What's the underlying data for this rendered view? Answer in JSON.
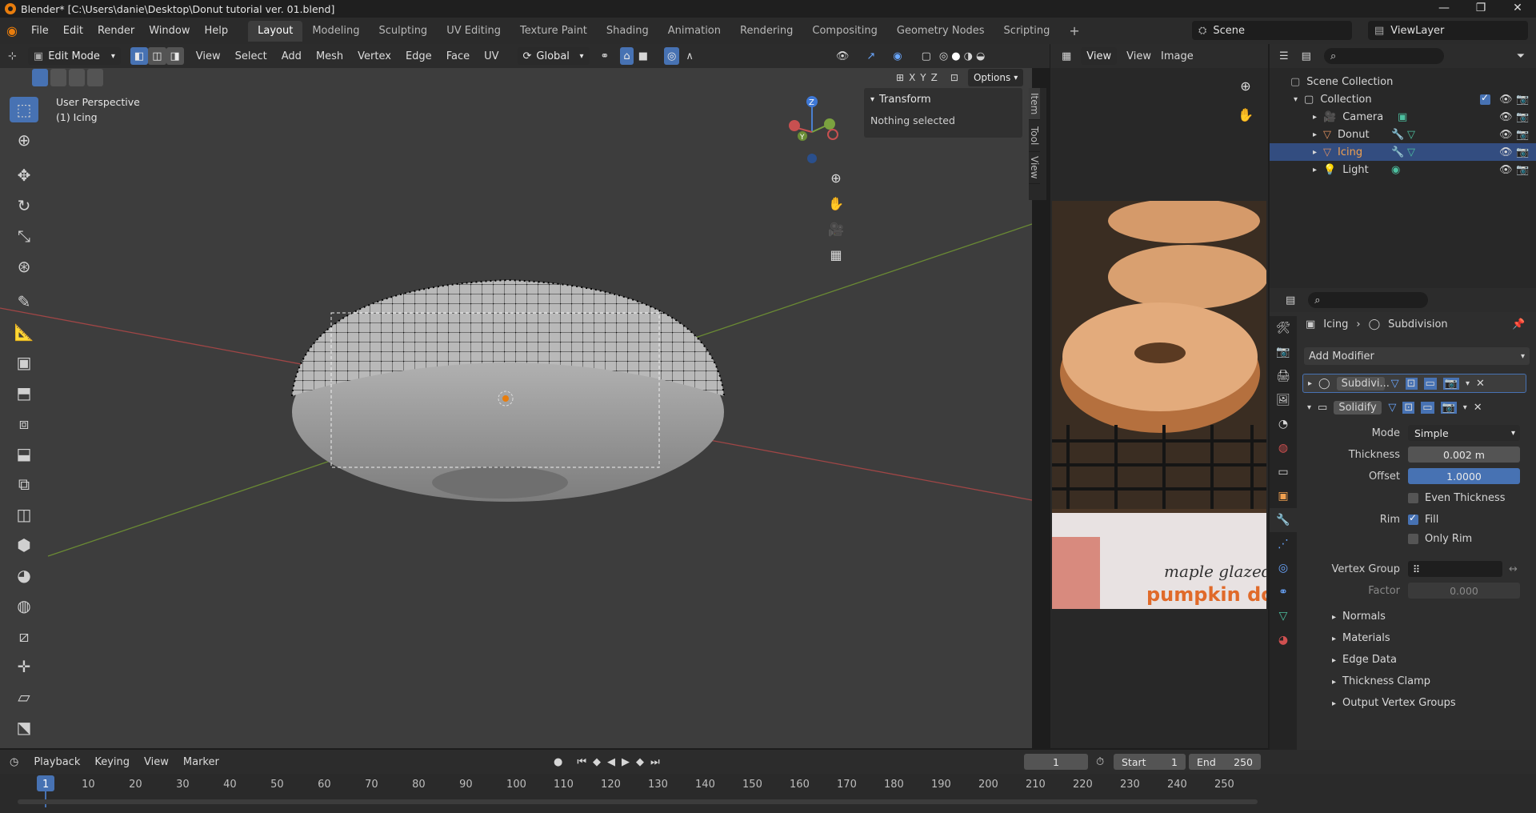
{
  "window": {
    "title": "Blender* [C:\\Users\\danie\\Desktop\\Donut tutorial ver. 01.blend]",
    "controls": [
      "—",
      "❐",
      "✕"
    ]
  },
  "menu": [
    "File",
    "Edit",
    "Render",
    "Window",
    "Help"
  ],
  "workspaces": [
    "Layout",
    "Modeling",
    "Sculpting",
    "UV Editing",
    "Texture Paint",
    "Shading",
    "Animation",
    "Rendering",
    "Compositing",
    "Geometry Nodes",
    "Scripting"
  ],
  "active_workspace": "Layout",
  "scene": {
    "scene": "Scene",
    "view_layer": "ViewLayer"
  },
  "viewport": {
    "mode": "Edit Mode",
    "menus": [
      "View",
      "Select",
      "Add",
      "Mesh",
      "Vertex",
      "Edge",
      "Face",
      "UV"
    ],
    "orientation": "Global",
    "perspective": "User Perspective",
    "object_label": "(1) Icing",
    "options": "Options",
    "axes": [
      "X",
      "Y",
      "Z"
    ],
    "gizmo": {
      "z": "Z",
      "y": "Y"
    }
  },
  "npanel": {
    "section": "Transform",
    "text": "Nothing selected",
    "tabs": [
      "Item",
      "Tool",
      "View"
    ]
  },
  "image_editor": {
    "menus": [
      "View",
      "View",
      "Image"
    ],
    "image_caption_1": "maple glazed",
    "image_caption_2": "pumpkin donut"
  },
  "outliner": {
    "root": "Scene Collection",
    "collection": "Collection",
    "items": [
      {
        "name": "Camera",
        "selected": false
      },
      {
        "name": "Donut",
        "selected": false
      },
      {
        "name": "Icing",
        "selected": true
      },
      {
        "name": "Light",
        "selected": false
      }
    ]
  },
  "properties": {
    "breadcrumb_object": "Icing",
    "breadcrumb_modifier": "Subdivision",
    "add_modifier": "Add Modifier",
    "modifiers": [
      "Subdivi...",
      "Solidify"
    ],
    "mode_label": "Mode",
    "mode_value": "Simple",
    "thickness_label": "Thickness",
    "thickness_value": "0.002 m",
    "offset_label": "Offset",
    "offset_value": "1.0000",
    "even_thickness": "Even Thickness",
    "rim_label": "Rim",
    "fill": "Fill",
    "only_rim": "Only Rim",
    "vertex_group_label": "Vertex Group",
    "factor_label": "Factor",
    "factor_value": "0.000",
    "subpanels": [
      "Normals",
      "Materials",
      "Edge Data",
      "Thickness Clamp",
      "Output Vertex Groups"
    ]
  },
  "timeline": {
    "menus": [
      "Playback",
      "Keying",
      "View",
      "Marker"
    ],
    "current_frame": "1",
    "start_label": "Start",
    "start": "1",
    "end_label": "End",
    "end": "250",
    "ticks": [
      "1",
      "10",
      "20",
      "30",
      "40",
      "50",
      "60",
      "70",
      "80",
      "90",
      "100",
      "110",
      "120",
      "130",
      "140",
      "150",
      "160",
      "170",
      "180",
      "190",
      "200",
      "210",
      "220",
      "230",
      "240",
      "250"
    ]
  },
  "colors": {
    "accent": "#4772b3",
    "brand": "#e87d0d",
    "x_axis": "#c85050",
    "y_axis": "#7ba23f"
  }
}
